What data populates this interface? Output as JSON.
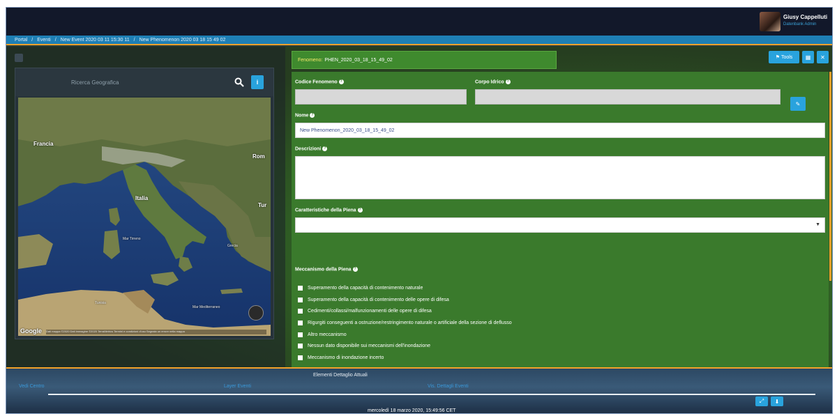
{
  "header": {
    "user_name": "Giusy Cappelluti",
    "user_role": "Datenbank Admin"
  },
  "breadcrumb": [
    "Portal",
    "Eventi",
    "New Event 2020 03 11 15:30 11",
    "New Phenomenon 2020 03 18 15 49 02"
  ],
  "map": {
    "search_placeholder": "Ricerca Geografica",
    "labels": {
      "france": "Francia",
      "italy": "Italia",
      "romania": "Rom",
      "turkey": "Tur",
      "greece": "Grecia",
      "tunisia": "Tunisia",
      "tyrrhenian": "Mar Tirreno",
      "mediterranean": "Mar Mediterraneo"
    },
    "google_label": "Google",
    "attribution": "Dati mappa ©2020 Dati immagine ©2020 TerraMetrics Termini e condizioni d'uso Segnala un errore nella mappa"
  },
  "phenomenon": {
    "label": "Fenomeno:",
    "value": "PHEN_2020_03_18_15_49_02"
  },
  "toolbar": {
    "tools_label": "Tools",
    "grid_icon": "grid-icon",
    "close_icon": "close-icon"
  },
  "form": {
    "codice_label": "Codice Fenomeno",
    "corpo_label": "Corpo Idrico",
    "nome_label": "Nome",
    "nome_value": "New Phenomenon_2020_03_18_15_49_02",
    "descrizione_label": "Descrizioni",
    "caratteristiche_label": "Caratteristiche della Piena",
    "meccanismo_label": "Meccanismo della Piena",
    "mechanisms": [
      "Superamento della capacità di contenimento naturale",
      "Superamento della capacità di contenimento delle opere di difesa",
      "Cedimenti/collassi/malfunzionamenti delle opere di difesa",
      "Rigurgiti conseguenti a ostruzione/restringimento naturale o artificiale della sezione di deflusso",
      "Altro meccanismo",
      "Nessun dato disponibile sui meccanismi dell'inondazione",
      "Meccanismo di inondazione incerto"
    ]
  },
  "bottom": {
    "active_layers": "Elementi Dettaglio Attuali",
    "links": [
      "Vedi Centro",
      "Layer Eventi",
      "Vis. Dettagli Eventi"
    ],
    "date": "mercoledì 18 marzo 2020, 15:49:56 CET"
  },
  "colors": {
    "accent_blue": "#29a3dd",
    "form_green": "#3a7a2c",
    "orange": "#f2a12a",
    "topbar": "#12182a"
  }
}
